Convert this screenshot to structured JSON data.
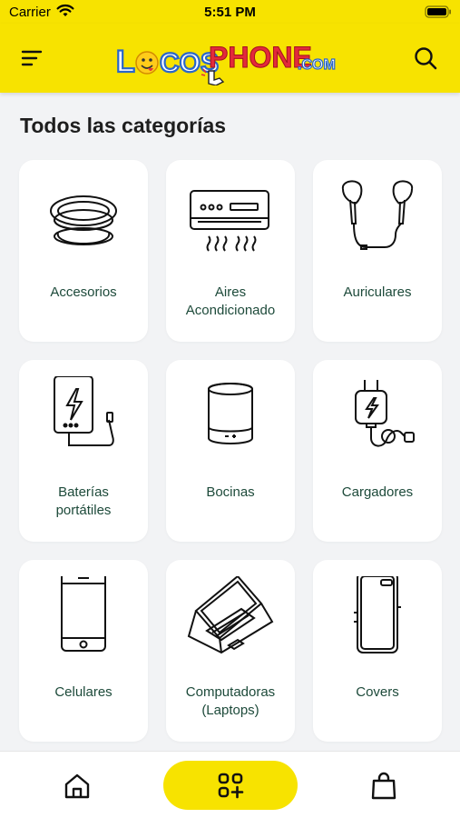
{
  "status_bar": {
    "carrier": "Carrier",
    "time": "5:51 PM"
  },
  "header": {
    "logo_text": {
      "part1": "L",
      "part2": "COS",
      "part3": "PHONE",
      "part4": ".COM"
    }
  },
  "section": {
    "title": "Todos las categorías"
  },
  "categories": [
    {
      "label": "Accesorios",
      "icon": "popsocket-icon"
    },
    {
      "label": "Aires\nAcondicionado",
      "icon": "air-conditioner-icon"
    },
    {
      "label": "Auriculares",
      "icon": "earphones-icon"
    },
    {
      "label": "Baterías\nportátiles",
      "icon": "power-bank-icon"
    },
    {
      "label": "Bocinas",
      "icon": "speaker-icon"
    },
    {
      "label": "Cargadores",
      "icon": "charger-icon"
    },
    {
      "label": "Celulares",
      "icon": "smartphone-icon"
    },
    {
      "label": "Computadoras\n(Laptops)",
      "icon": "laptop-icon"
    },
    {
      "label": "Covers",
      "icon": "phone-cover-icon"
    }
  ],
  "bottom_nav": [
    {
      "icon": "home-icon"
    },
    {
      "icon": "categories-icon",
      "active": true
    },
    {
      "icon": "shopping-bag-icon"
    }
  ],
  "colors": {
    "brand_yellow": "#f7e300",
    "label_green": "#1d4a3a",
    "background": "#f2f3f5"
  }
}
